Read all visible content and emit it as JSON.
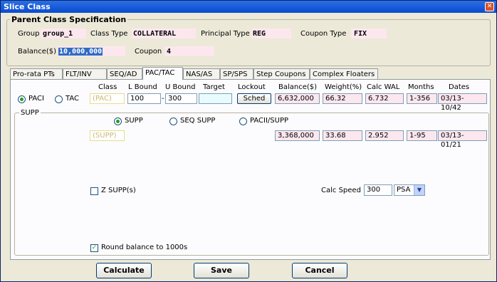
{
  "window": {
    "title": "Slice Class"
  },
  "spec": {
    "legend": "Parent Class Specification",
    "group_label": "Group",
    "group_value": "group_1",
    "class_type_label": "Class Type",
    "class_type_value": "COLLATERAL",
    "principal_type_label": "Principal Type",
    "principal_type_value": "REG",
    "coupon_type_label": "Coupon Type",
    "coupon_type_value": "FIX",
    "balance_label": "Balance($)",
    "balance_value": "10,000,000",
    "coupon_label": "Coupon",
    "coupon_value": "4"
  },
  "tabs": [
    "Pro-rata PTs",
    "FLT/INV",
    "SEQ/AD",
    "PAC/TAC",
    "NAS/AS",
    "SP/SPS",
    "Step Coupons",
    "Complex Floaters"
  ],
  "active_tab": "PAC/TAC",
  "headers": {
    "class": "Class",
    "lbound": "L Bound",
    "ubound": "U Bound",
    "target": "Target",
    "lockout": "Lockout",
    "balance": "Balance($)",
    "weight": "Weight(%)",
    "calcwal": "Calc WAL",
    "months": "Months",
    "dates": "Dates"
  },
  "pac_row": {
    "paci_label": "PACI",
    "tac_label": "TAC",
    "class_value": "(PAC)",
    "lbound": "100",
    "dash": "-",
    "ubound": "300",
    "target": "",
    "sched_label": "Sched",
    "balance": "6,632,000",
    "weight": "66.32",
    "calcwal": "6.732",
    "months": "1-356",
    "dates": "03/13-10/42"
  },
  "supp": {
    "legend": "SUPP",
    "opt_supp": "SUPP",
    "opt_seq_supp": "SEQ SUPP",
    "opt_pacii_supp": "PACII/SUPP",
    "class_value": "(SUPP)",
    "balance": "3,368,000",
    "weight": "33.68",
    "calcwal": "2.952",
    "months": "1-95",
    "dates": "03/13-01/21",
    "zsupp_label": "Z SUPP(s)",
    "zsupp_checked": false,
    "calc_speed_label": "Calc Speed",
    "calc_speed_value": "300",
    "speed_unit": "PSA",
    "round_label": "Round balance to 1000s",
    "round_checked": true
  },
  "buttons": {
    "calculate": "Calculate",
    "save": "Save",
    "cancel": "Cancel"
  },
  "colors": {
    "title_bar": "#0a4ad0",
    "pink_field": "#fde7ee",
    "check_green": "#21a121"
  }
}
